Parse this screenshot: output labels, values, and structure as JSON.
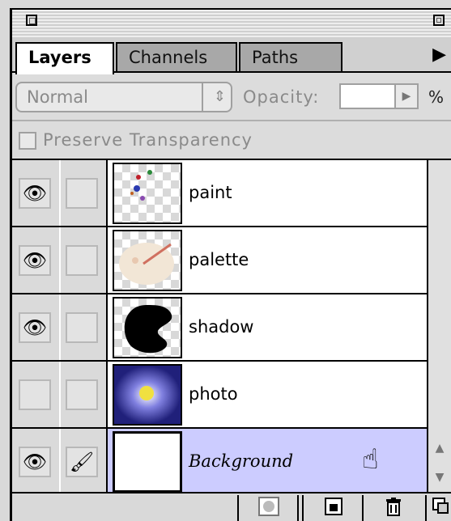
{
  "tabs": [
    {
      "label": "Layers",
      "active": true
    },
    {
      "label": "Channels",
      "active": false
    },
    {
      "label": "Paths",
      "active": false
    }
  ],
  "controls": {
    "blend_mode": "Normal",
    "opacity_label": "Opacity:",
    "opacity_value": "",
    "percent": "%",
    "preserve_label": "Preserve Transparency"
  },
  "layers": [
    {
      "name": "paint",
      "visible": true
    },
    {
      "name": "palette",
      "visible": true
    },
    {
      "name": "shadow",
      "visible": true
    },
    {
      "name": "photo",
      "visible": false
    },
    {
      "name": "Background",
      "visible": true,
      "selected": true
    }
  ],
  "colors": {
    "selected_row": "#ccccff",
    "panel_bg": "#d9d9d9"
  },
  "icons": [
    "eye-icon",
    "brush-icon",
    "hand-cursor-icon",
    "layer-mask-icon",
    "new-layer-icon",
    "trash-icon",
    "panel-menu-arrow-icon"
  ]
}
